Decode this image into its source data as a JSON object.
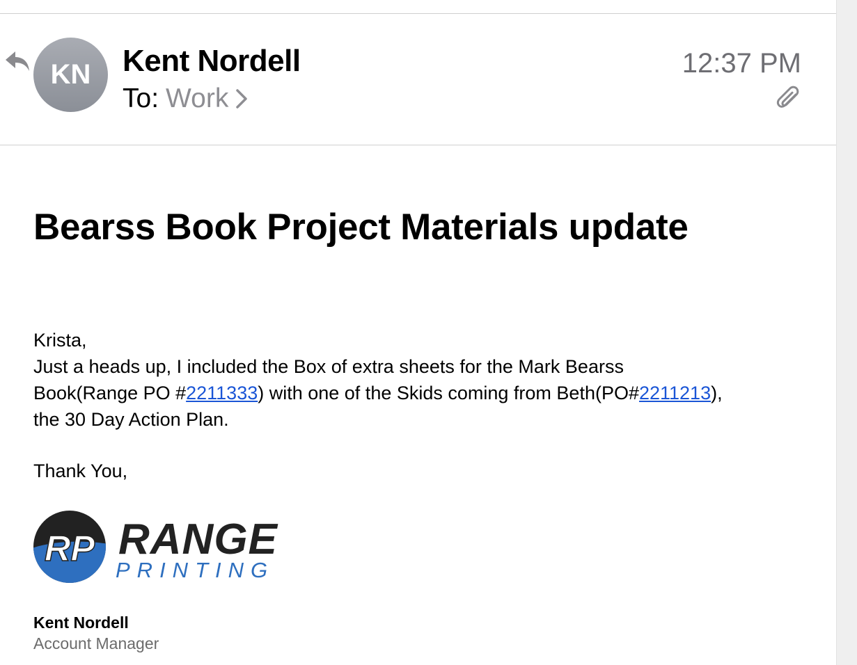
{
  "header": {
    "avatar_initials": "KN",
    "sender_name": "Kent Nordell",
    "to_label": "To:",
    "to_value": "Work",
    "time": "12:37 PM",
    "reply_icon": "reply-arrow-icon",
    "chevron_icon": "chevron-right-icon",
    "attachment_icon": "paperclip-icon"
  },
  "message": {
    "subject": "Bearss Book Project Materials update",
    "greeting": "Krista,",
    "line1": "Just a heads up, I included the Box of extra sheets for the Mark Bearss",
    "line2_before": "Book(Range PO #",
    "po_range": "2211333",
    "line2_middle": ") with one of the Skids coming from Beth(PO#",
    "po_beth": "2211213",
    "line2_after": "),",
    "line3": "the 30 Day Action Plan.",
    "signoff": "Thank You,"
  },
  "signature": {
    "logo_monogram": "RP",
    "logo_word": "RANGE",
    "logo_subword": "PRINTING",
    "name": "Kent Nordell",
    "title": "Account Manager"
  },
  "colors": {
    "link": "#1a55d6",
    "logo_blue": "#2e6fbf",
    "logo_dark": "#222222",
    "muted_gray": "#8e8e93"
  }
}
